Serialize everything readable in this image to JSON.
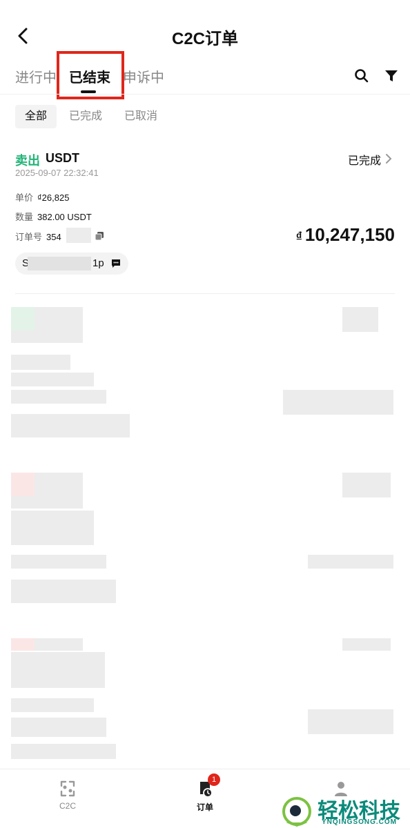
{
  "header": {
    "title": "C2C订单"
  },
  "tabs": [
    {
      "label": "进行中"
    },
    {
      "label": "已结束"
    },
    {
      "label": "申诉中"
    }
  ],
  "subtabs": [
    {
      "label": "全部"
    },
    {
      "label": "已完成"
    },
    {
      "label": "已取消"
    }
  ],
  "order": {
    "side": "卖出",
    "asset": "USDT",
    "status": "已完成",
    "time": "2025-09-07 22:32:41",
    "price_label": "单价",
    "price_value": "₫26,825",
    "qty_label": "数量",
    "qty_value": "382.00 USDT",
    "id_label": "订单号",
    "id_value": "354",
    "amount_currency": "₫",
    "amount_value": "10,247,150",
    "counterparty_prefix": "S",
    "counterparty_suffix": "1p"
  },
  "bottom_nav": [
    {
      "label": "C2C",
      "icon": "c2c-icon"
    },
    {
      "label": "订单",
      "icon": "orders-icon",
      "badge": "1"
    },
    {
      "label": "",
      "icon": "profile-icon"
    }
  ],
  "watermark": {
    "text": "轻松科技",
    "sub": "YNQINGSONG.COM"
  },
  "colors": {
    "accent": "#21b377",
    "highlight": "#e0261b"
  }
}
